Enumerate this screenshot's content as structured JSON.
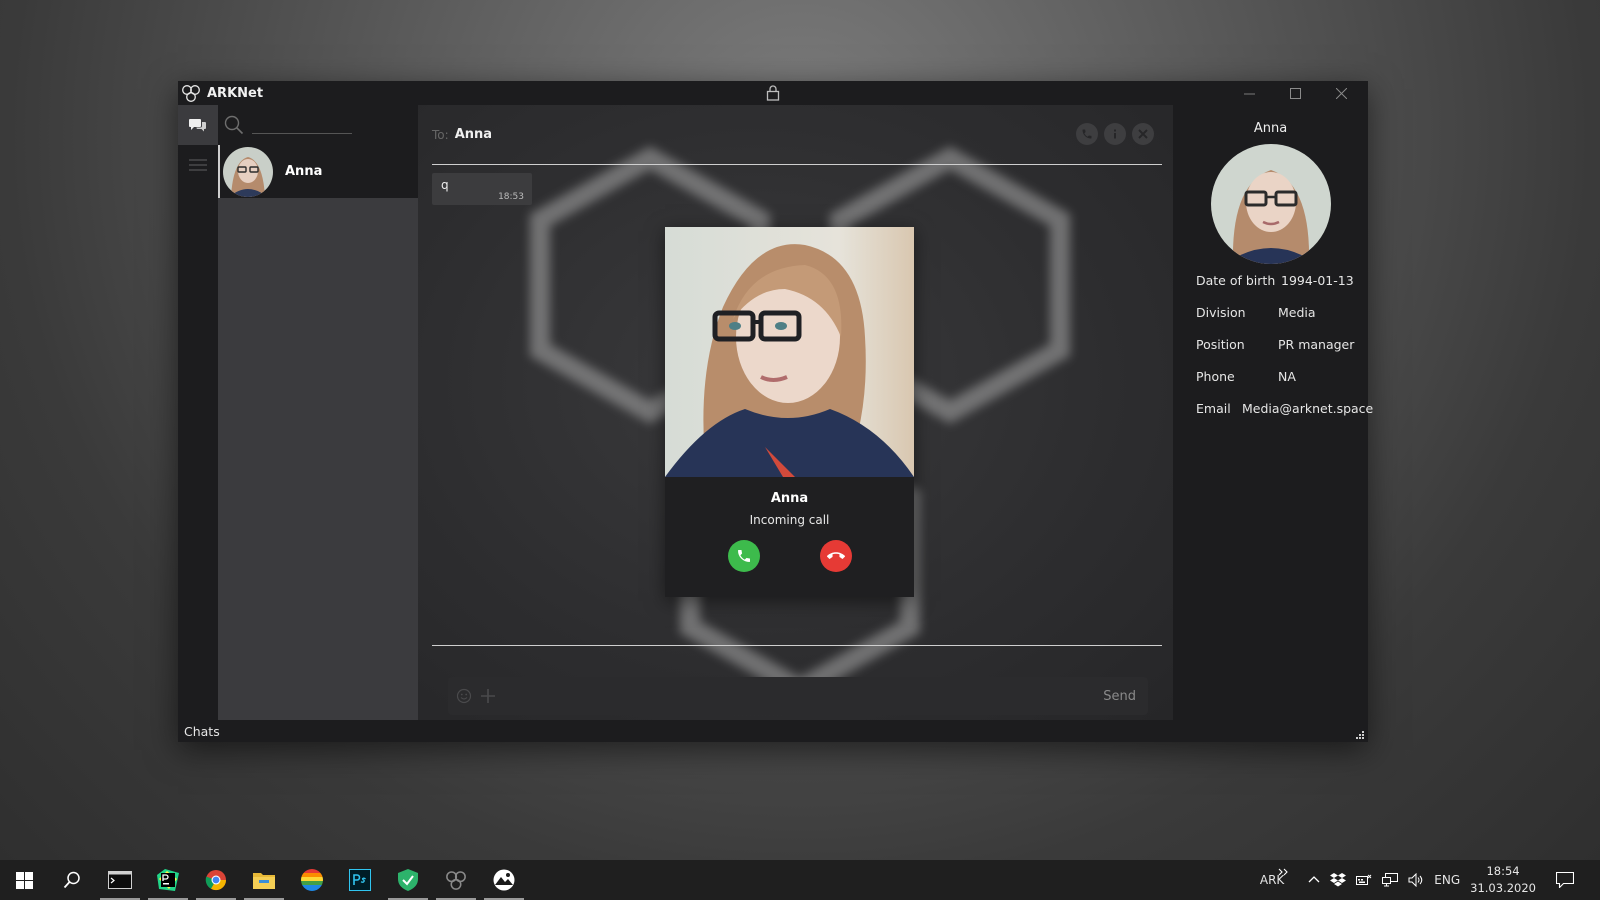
{
  "window": {
    "title": "ARKNet",
    "status_label": "Chats"
  },
  "chat_list": {
    "items": [
      {
        "name": "Anna"
      }
    ]
  },
  "conversation": {
    "to_label": "To:",
    "recipient": "Anna",
    "messages": [
      {
        "text": "q",
        "time": "18:53"
      }
    ],
    "composer": {
      "placeholder": "",
      "send_label": "Send"
    }
  },
  "call": {
    "caller_name": "Anna",
    "status": "Incoming call",
    "accept_color": "#3dbb4c",
    "decline_color": "#e63a35"
  },
  "profile": {
    "name": "Anna",
    "fields": {
      "dob": {
        "label": "Date of birth",
        "value": "1994-01-13"
      },
      "division": {
        "label": "Division",
        "value": "Media"
      },
      "position": {
        "label": "Position",
        "value": "PR manager"
      },
      "phone": {
        "label": "Phone",
        "value": "NA"
      },
      "email": {
        "label": "Email",
        "value": "Media@arknet.space"
      }
    }
  },
  "taskbar": {
    "tray_label": "ARK",
    "language": "ENG",
    "time": "18:54",
    "date": "31.03.2020"
  }
}
